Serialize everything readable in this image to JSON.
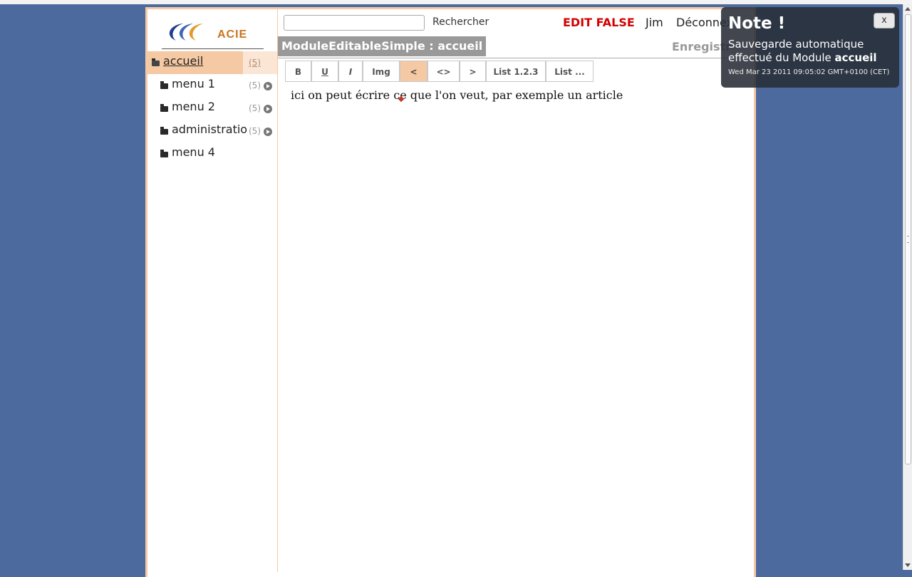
{
  "logo": {
    "text": "ACIE"
  },
  "sidebar": {
    "items": [
      {
        "label": "accueil",
        "count": "(5)",
        "active": true,
        "has_arrow": false
      },
      {
        "label": "menu 1",
        "count": "(5)",
        "active": false,
        "has_arrow": true
      },
      {
        "label": "menu 2",
        "count": "(5)",
        "active": false,
        "has_arrow": true
      },
      {
        "label": "administratio",
        "count": "(5)",
        "active": false,
        "has_arrow": true
      },
      {
        "label": "menu 4",
        "count": "",
        "active": false,
        "has_arrow": false
      }
    ]
  },
  "header": {
    "search_placeholder": "",
    "search_button": "Rechercher",
    "edit_status": "EDIT FALSE",
    "user": "Jim",
    "logout": "Déconnex"
  },
  "module": {
    "title": "ModuleEditableSimple : accueil",
    "save_label": "Enregistr"
  },
  "toolbar": {
    "buttons": [
      "B",
      "U",
      "I",
      "Img",
      "<",
      "<>",
      ">",
      "List 1.2.3",
      "List ..."
    ]
  },
  "editor": {
    "content": "ici on peut écrire ce que l'on veut, par exemple un article"
  },
  "note": {
    "title": "Note !",
    "body_prefix": "Sauvegarde automatique effectué du Module ",
    "module_name": "accueil",
    "date": "Wed Mar 23 2011 09:05:02 GMT+0100 (CET)",
    "close": "x"
  },
  "colors": {
    "background": "#4d6a9f",
    "accent": "#f5c9a3",
    "edit_status": "#d40000"
  }
}
